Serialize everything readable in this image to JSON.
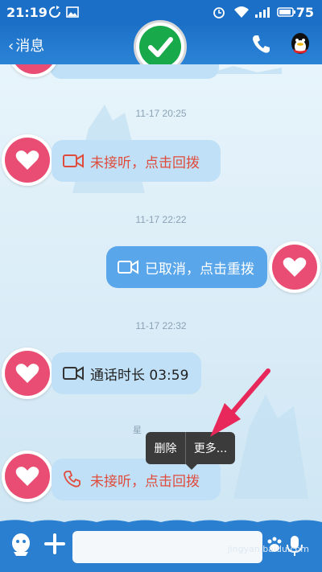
{
  "status_bar": {
    "time": "21:19",
    "battery": "75"
  },
  "header": {
    "back_label": "消息",
    "icons": [
      "sync-icon",
      "image-icon",
      "alarm-icon",
      "wifi-icon",
      "signal-icon",
      "battery-icon",
      "phone-icon",
      "qq-avatar-icon",
      "check-icon"
    ]
  },
  "messages": [
    {
      "timestamp": "11-17 20:25",
      "side": "left",
      "text": "未接听，点击回拨",
      "icon": "video-camera-icon",
      "missed": true
    },
    {
      "timestamp": "11-17 22:22",
      "side": "right",
      "text": "已取消，点击重拨",
      "icon": "video-camera-icon",
      "missed": false
    },
    {
      "timestamp": "11-17 22:32",
      "side": "left",
      "text": "通话时长 03:59",
      "icon": "video-camera-icon",
      "missed": false
    },
    {
      "timestamp": "星",
      "side": "left",
      "text": "未接听，点击回拨",
      "icon": "phone-icon",
      "missed": true
    }
  ],
  "context_menu": {
    "delete_label": "删除",
    "more_label": "更多..."
  },
  "watermark": "jingyan.baidu.com",
  "colors": {
    "header_blue": "#1b6fc6",
    "missed_red": "#e04b3c",
    "heart_pink": "#e94d73",
    "sent_bubble": "#5aa6ea"
  }
}
